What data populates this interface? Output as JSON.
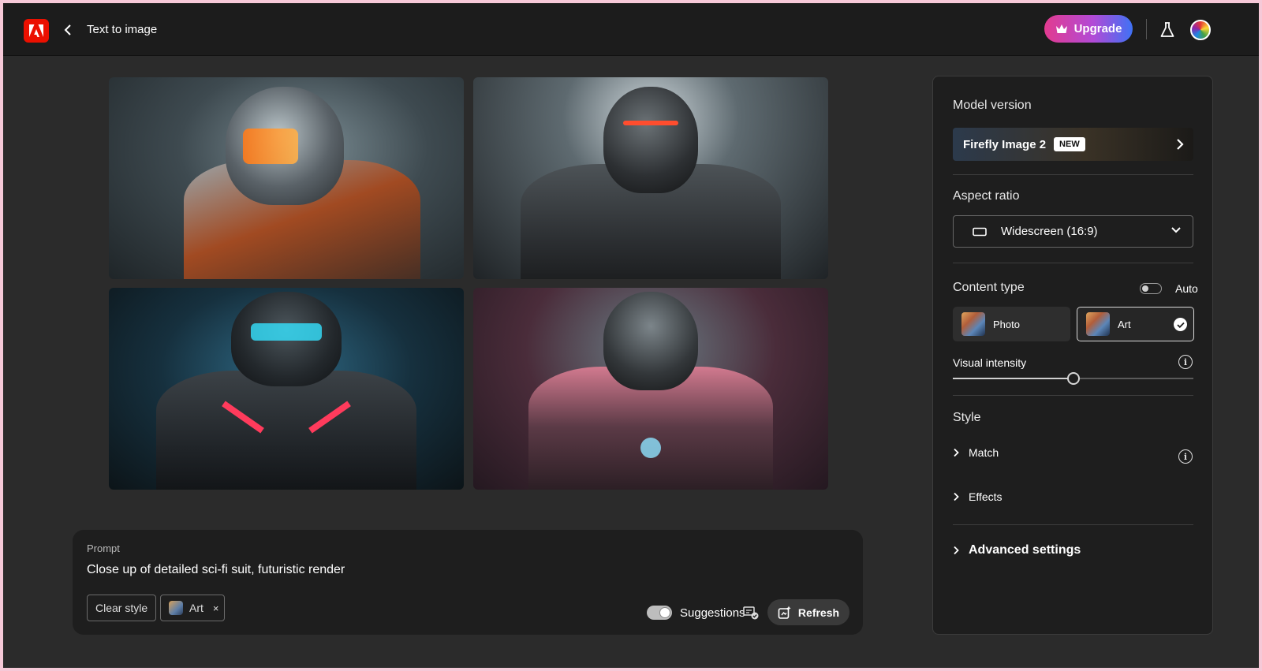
{
  "header": {
    "back_label": "Text to image",
    "upgrade_label": "Upgrade"
  },
  "images": [
    {
      "name": "generated-image-1"
    },
    {
      "name": "generated-image-2"
    },
    {
      "name": "generated-image-3"
    },
    {
      "name": "generated-image-4"
    }
  ],
  "prompt": {
    "label": "Prompt",
    "text": "Close up of detailed sci-fi suit, futuristic render",
    "clear_style_label": "Clear style",
    "style_chip_label": "Art",
    "style_chip_remove": "×",
    "suggestions_label": "Suggestions",
    "suggestions_on": true,
    "refresh_label": "Refresh"
  },
  "sidebar": {
    "model_version": {
      "heading": "Model version",
      "value": "Firefly Image 2",
      "badge": "NEW"
    },
    "aspect_ratio": {
      "heading": "Aspect ratio",
      "selected": "Widescreen (16:9)"
    },
    "content_type": {
      "heading": "Content type",
      "auto_label": "Auto",
      "auto_on": false,
      "options": [
        {
          "label": "Photo",
          "selected": false
        },
        {
          "label": "Art",
          "selected": true
        }
      ]
    },
    "visual_intensity": {
      "label": "Visual intensity",
      "value": 0.5
    },
    "style": {
      "heading": "Style",
      "match_label": "Match",
      "effects_label": "Effects"
    },
    "advanced_label": "Advanced settings"
  },
  "colors": {
    "adobe_red": "#eb1000",
    "upgrade_gradient_start": "#e23b8f",
    "upgrade_gradient_end": "#3f72f5",
    "panel_bg": "#1e1e1e",
    "page_bg": "#2b2b2b"
  }
}
